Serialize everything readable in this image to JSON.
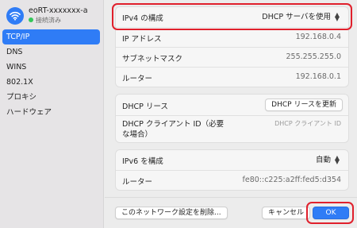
{
  "network": {
    "name": "eoRT-xxxxxxx-a",
    "status": "接続済み",
    "icon": "wifi-icon",
    "status_color": "#34c759"
  },
  "sidebar": {
    "items": [
      {
        "label": "TCP/IP",
        "selected": true
      },
      {
        "label": "DNS"
      },
      {
        "label": "WINS"
      },
      {
        "label": "802.1X"
      },
      {
        "label": "プロキシ"
      },
      {
        "label": "ハードウェア"
      }
    ]
  },
  "ipv4": {
    "config_label": "IPv4 の構成",
    "config_value": "DHCP サーバを使用",
    "ip_label": "IP アドレス",
    "ip_value": "192.168.0.4",
    "subnet_label": "サブネットマスク",
    "subnet_value": "255.255.255.0",
    "router_label": "ルーター",
    "router_value": "192.168.0.1"
  },
  "dhcp": {
    "lease_label": "DHCP リース",
    "renew_button": "DHCP リースを更新",
    "client_id_label_line1": "DHCP クライアント ID（必要",
    "client_id_label_line2": "な場合）",
    "client_id_placeholder": "DHCP クライアント ID"
  },
  "ipv6": {
    "config_label": "IPv6 を構成",
    "config_value": "自動",
    "router_label": "ルーター",
    "router_value": "fe80::c225:a2ff:fed5:d354"
  },
  "footer": {
    "delete_button": "このネットワーク設定を削除...",
    "cancel_button": "キャンセル",
    "ok_button": "OK"
  },
  "colors": {
    "accent": "#2f7cf6",
    "highlight": "#e0202c"
  }
}
